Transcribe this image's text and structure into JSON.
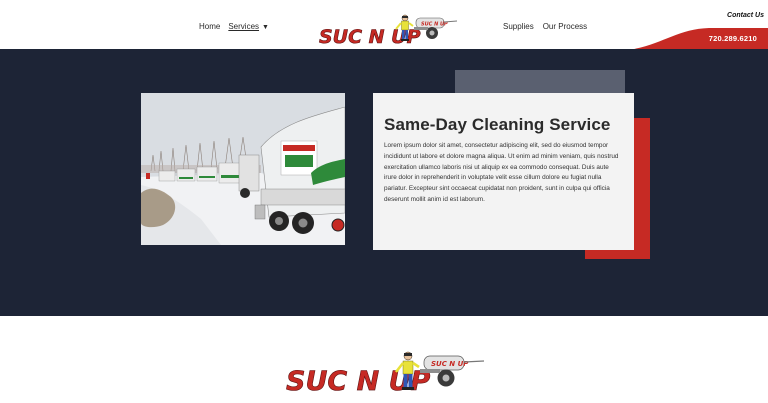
{
  "header": {
    "nav_left": [
      {
        "label": "Home"
      },
      {
        "label": "Services"
      }
    ],
    "services_caret": "▼",
    "nav_right": [
      {
        "label": "Supplies"
      },
      {
        "label": "Our Process"
      }
    ],
    "logo": {
      "wordmark": "SUC N UP",
      "truck_sign": "SUC N UP"
    },
    "contact_label": "Contact Us",
    "phone": "720.289.6210"
  },
  "hero": {
    "title": "Same-Day Cleaning Service",
    "body": "Lorem ipsum dolor sit amet, consectetur adipiscing elit, sed do eiusmod tempor incididunt ut labore et dolore magna aliqua. Ut enim ad minim veniam, quis nostrud exercitation ullamco laboris nisi ut aliquip ex ea commodo consequat. Duis aute irure dolor in reprehenderit in voluptate velit esse cillum dolore eu fugiat nulla pariatur. Excepteur sint occaecat cupidatat non proident, sunt in culpa qui officia deserunt mollit anim id est laborum."
  },
  "footer": {
    "logo": {
      "wordmark": "SUC N UP",
      "truck_sign": "SUC N UP"
    }
  },
  "colors": {
    "navy": "#1d2436",
    "red": "#c62a24",
    "gray_block": "#5a6070",
    "card_bg": "#f3f3f3"
  }
}
